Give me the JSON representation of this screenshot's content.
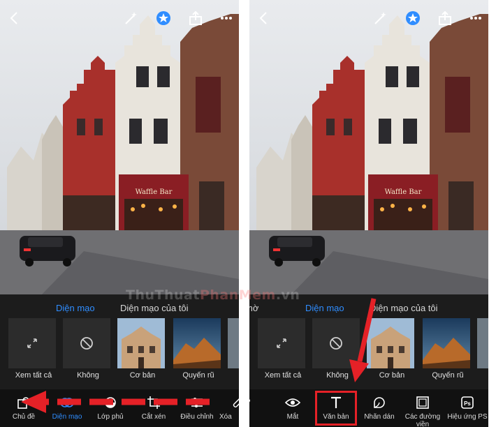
{
  "colors": {
    "accent": "#2f8dff",
    "annotation_red": "#e52127",
    "panel_bg": "#1c1c1c"
  },
  "watermark": {
    "part1": "ThuThuat",
    "part2": "PhanMem",
    "part3": ".vn"
  },
  "left": {
    "looks": {
      "tab_active": "Diện mạo",
      "tab_inactive": "Diện mạo của tôi"
    },
    "presets": [
      {
        "label": "Xem tất cả",
        "icon": "expand-arrows-icon"
      },
      {
        "label": "Không",
        "icon": "none-circle-icon"
      },
      {
        "label": "Cơ bản",
        "icon": "photo-thumbnail"
      },
      {
        "label": "Quyến rũ",
        "icon": "mountain-thumbnail"
      }
    ],
    "tools": [
      {
        "label": "Chủ đề",
        "icon": "theme-icon"
      },
      {
        "label": "Diện mạo",
        "icon": "looks-icon"
      },
      {
        "label": "Lớp phủ",
        "icon": "overlay-icon"
      },
      {
        "label": "Cắt xén",
        "icon": "crop-icon"
      },
      {
        "label": "Điều chỉnh",
        "icon": "adjust-icon"
      },
      {
        "label": "Xóa",
        "icon": "heal-icon"
      }
    ]
  },
  "right": {
    "looks": {
      "tab_partial": "mờ",
      "tab_active": "Diện mạo",
      "tab_inactive": "Diện mạo của tôi"
    },
    "presets": [
      {
        "label": "Xem tất cả",
        "icon": "expand-arrows-icon"
      },
      {
        "label": "Không",
        "icon": "none-circle-icon"
      },
      {
        "label": "Cơ bản",
        "icon": "photo-thumbnail"
      },
      {
        "label": "Quyến rũ",
        "icon": "mountain-thumbnail"
      }
    ],
    "tools": [
      {
        "label": "Mắt",
        "icon": "eye-icon"
      },
      {
        "label": "Văn bản",
        "icon": "text-icon"
      },
      {
        "label": "Nhãn dán",
        "icon": "sticker-icon"
      },
      {
        "label": "Các đường",
        "label2": "viền",
        "icon": "border-icon"
      },
      {
        "label": "Hiệu ứng PS",
        "icon": "ps-effects-icon"
      }
    ]
  },
  "photo": {
    "shop_sign": "Waffle Bar"
  }
}
